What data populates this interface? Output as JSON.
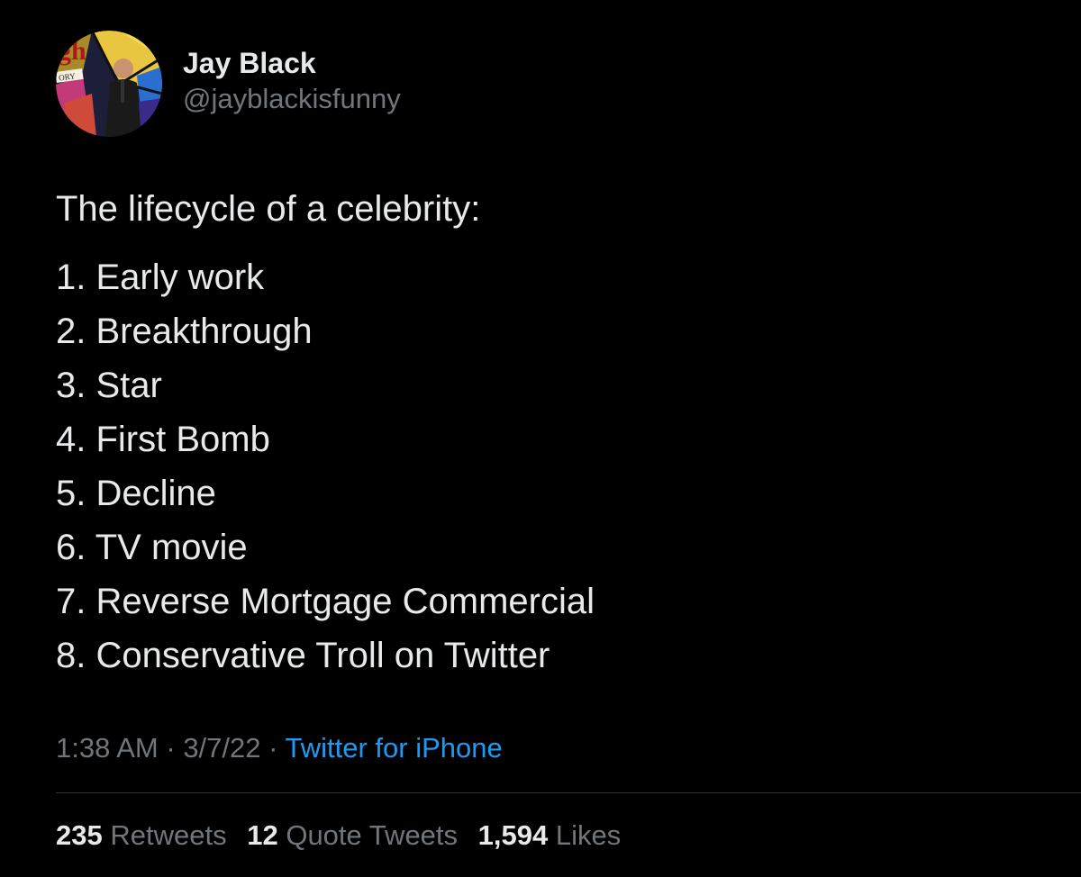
{
  "author": {
    "display_name": "Jay Black",
    "handle": "@jayblackisfunny",
    "avatar_logo_text": "gh",
    "avatar_sign_text": "ORY"
  },
  "tweet": {
    "intro": "The lifecycle of a celebrity:",
    "items": [
      "1. Early work",
      "2. Breakthrough",
      "3. Star",
      "4. First Bomb",
      "5. Decline",
      "6. TV movie",
      "7. Reverse Mortgage Commercial",
      "8. Conservative Troll on Twitter"
    ]
  },
  "meta": {
    "time": "1:38 AM",
    "separator": " · ",
    "date": "3/7/22",
    "source": "Twitter for iPhone"
  },
  "stats": {
    "retweets_count": "235",
    "retweets_label": "Retweets",
    "quotes_count": "12",
    "quotes_label": "Quote Tweets",
    "likes_count": "1,594",
    "likes_label": "Likes"
  },
  "colors": {
    "background": "#000000",
    "primary_text": "#e7e9ea",
    "secondary_text": "#71767b",
    "link": "#1d9bf0",
    "divider": "#2f3336"
  }
}
